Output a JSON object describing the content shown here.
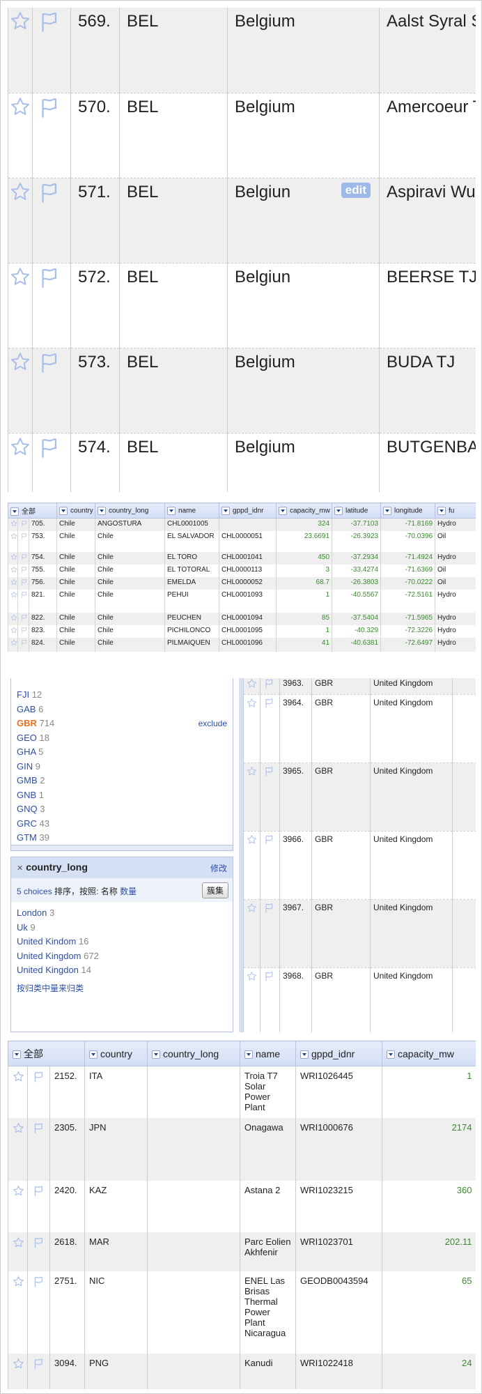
{
  "panel1": {
    "rows": [
      {
        "idx": "569.",
        "country": "BEL",
        "country_long": "Belgium",
        "name": "Aalst Syral S",
        "edit": ""
      },
      {
        "idx": "570.",
        "country": "BEL",
        "country_long": "Belgium",
        "name": "Amercoeur TGV",
        "edit": ""
      },
      {
        "idx": "571.",
        "country": "BEL",
        "country_long": "Belgiun",
        "name": "Aspiravi Wuustwezel",
        "edit": "edit"
      },
      {
        "idx": "572.",
        "country": "BEL",
        "country_long": "Belgiun",
        "name": "BEERSE TJ",
        "edit": ""
      },
      {
        "idx": "573.",
        "country": "BEL",
        "country_long": "Belgium",
        "name": "BUDA TJ",
        "edit": ""
      },
      {
        "idx": "574.",
        "country": "BEL",
        "country_long": "Belgium",
        "name": "BUTGENBA",
        "edit": ""
      }
    ]
  },
  "panel2": {
    "headers": {
      "all": "全部",
      "country": "country",
      "country_long": "country_long",
      "name": "name",
      "gppd_idnr": "gppd_idnr",
      "capacity_mw": "capacity_mw",
      "latitude": "latitude",
      "longitude": "longitude",
      "fuel": "fu"
    },
    "rows": [
      {
        "idx": "705.",
        "country": "Chile",
        "country_long": "ANGOSTURA",
        "name": "CHL0001005",
        "gppd": "",
        "cap": "324",
        "lat": "-37.7103",
        "lon": "-71.8169",
        "fuel": "Hydro"
      },
      {
        "idx": "753.",
        "country": "Chile",
        "country_long": "Chile",
        "name": "EL SALVADOR",
        "gppd": "CHL0000051",
        "cap": "23.6691",
        "lat": "-26.3923",
        "lon": "-70.0396",
        "fuel": "Oil"
      },
      {
        "idx": "754.",
        "country": "Chile",
        "country_long": "Chile",
        "name": "EL TORO",
        "gppd": "CHL0001041",
        "cap": "450",
        "lat": "-37.2934",
        "lon": "-71.4924",
        "fuel": "Hydro"
      },
      {
        "idx": "755.",
        "country": "Chile",
        "country_long": "Chile",
        "name": "EL TOTORAL",
        "gppd": "CHL0000113",
        "cap": "3",
        "lat": "-33.4274",
        "lon": "-71.6369",
        "fuel": "Oil"
      },
      {
        "idx": "756.",
        "country": "Chile",
        "country_long": "Chile",
        "name": "EMELDA",
        "gppd": "CHL0000052",
        "cap": "68.7",
        "lat": "-26.3803",
        "lon": "-70.0222",
        "fuel": "Oil"
      },
      {
        "idx": "821.",
        "country": "Chile",
        "country_long": "Chile",
        "name": "PEHUI",
        "gppd": "CHL0001093",
        "cap": "1",
        "lat": "-40.5567",
        "lon": "-72.5161",
        "fuel": "Hydro"
      },
      {
        "idx": "822.",
        "country": "Chile",
        "country_long": "Chile",
        "name": "PEUCHEN",
        "gppd": "CHL0001094",
        "cap": "85",
        "lat": "-37.5404",
        "lon": "-71.5965",
        "fuel": "Hydro"
      },
      {
        "idx": "823.",
        "country": "Chile",
        "country_long": "Chile",
        "name": "PICHILONCO",
        "gppd": "CHL0001095",
        "cap": "1",
        "lat": "-40.329",
        "lon": "-72.3226",
        "fuel": "Hydro"
      },
      {
        "idx": "824.",
        "country": "Chile",
        "country_long": "Chile",
        "name": "PILMAIQUEN",
        "gppd": "CHL0001096",
        "cap": "41",
        "lat": "-40.6381",
        "lon": "-72.6497",
        "fuel": "Hydro"
      }
    ]
  },
  "facet_country": {
    "choices": [
      {
        "name": "FJI",
        "count": "12"
      },
      {
        "name": "GAB",
        "count": "6"
      },
      {
        "name": "GBR",
        "count": "714",
        "selected": true
      },
      {
        "name": "GEO",
        "count": "18"
      },
      {
        "name": "GHA",
        "count": "5"
      },
      {
        "name": "GIN",
        "count": "9"
      },
      {
        "name": "GMB",
        "count": "2"
      },
      {
        "name": "GNB",
        "count": "1"
      },
      {
        "name": "GNQ",
        "count": "3"
      },
      {
        "name": "GRC",
        "count": "43"
      },
      {
        "name": "GTM",
        "count": "39"
      }
    ],
    "exclude": "exclude"
  },
  "facet_country_long": {
    "title": "country_long",
    "change": "修改",
    "choices_count": "5 choices",
    "sort_label": "排序，按照:",
    "sort_name": "名称",
    "sort_count": "数量",
    "cluster": "簇集",
    "choices": [
      {
        "name": "London",
        "count": "3"
      },
      {
        "name": "Uk",
        "count": "9"
      },
      {
        "name": "United Kindom",
        "count": "16"
      },
      {
        "name": "United Kingdom",
        "count": "672"
      },
      {
        "name": "United Kingdon",
        "count": "14"
      }
    ],
    "footer": "按归类中量来归类"
  },
  "panel3_table": {
    "rows": [
      {
        "idx": "3963.",
        "country": "GBR",
        "country_long": "United Kingdom",
        "partial": true
      },
      {
        "idx": "3964.",
        "country": "GBR",
        "country_long": "United Kingdom"
      },
      {
        "idx": "3965.",
        "country": "GBR",
        "country_long": "United Kingdom"
      },
      {
        "idx": "3966.",
        "country": "GBR",
        "country_long": "United Kingdom"
      },
      {
        "idx": "3967.",
        "country": "GBR",
        "country_long": "United Kingdom"
      },
      {
        "idx": "3968.",
        "country": "GBR",
        "country_long": "United Kingdom"
      }
    ]
  },
  "panel4": {
    "headers": {
      "all": "全部",
      "country": "country",
      "country_long": "country_long",
      "name": "name",
      "gppd_idnr": "gppd_idnr",
      "capacity_mw": "capacity_mw"
    },
    "rows": [
      {
        "idx": "2152.",
        "country": "ITA",
        "country_long": "",
        "name": "Troia T7 Solar Power Plant",
        "gppd": "WRI1026445",
        "cap": "1"
      },
      {
        "idx": "2305.",
        "country": "JPN",
        "country_long": "",
        "name": "Onagawa",
        "gppd": "WRI1000676",
        "cap": "2174"
      },
      {
        "idx": "2420.",
        "country": "KAZ",
        "country_long": "",
        "name": "Astana 2",
        "gppd": "WRI1023215",
        "cap": "360"
      },
      {
        "idx": "2618.",
        "country": "MAR",
        "country_long": "",
        "name": "Parc Eolien Akhfenir",
        "gppd": "WRI1023701",
        "cap": "202.11"
      },
      {
        "idx": "2751.",
        "country": "NIC",
        "country_long": "",
        "name": "ENEL Las Brisas Thermal Power Plant Nicaragua",
        "gppd": "GEODB0043594",
        "cap": "65"
      },
      {
        "idx": "3094.",
        "country": "PNG",
        "country_long": "",
        "name": "Kanudi",
        "gppd": "WRI1022418",
        "cap": "24"
      }
    ]
  }
}
